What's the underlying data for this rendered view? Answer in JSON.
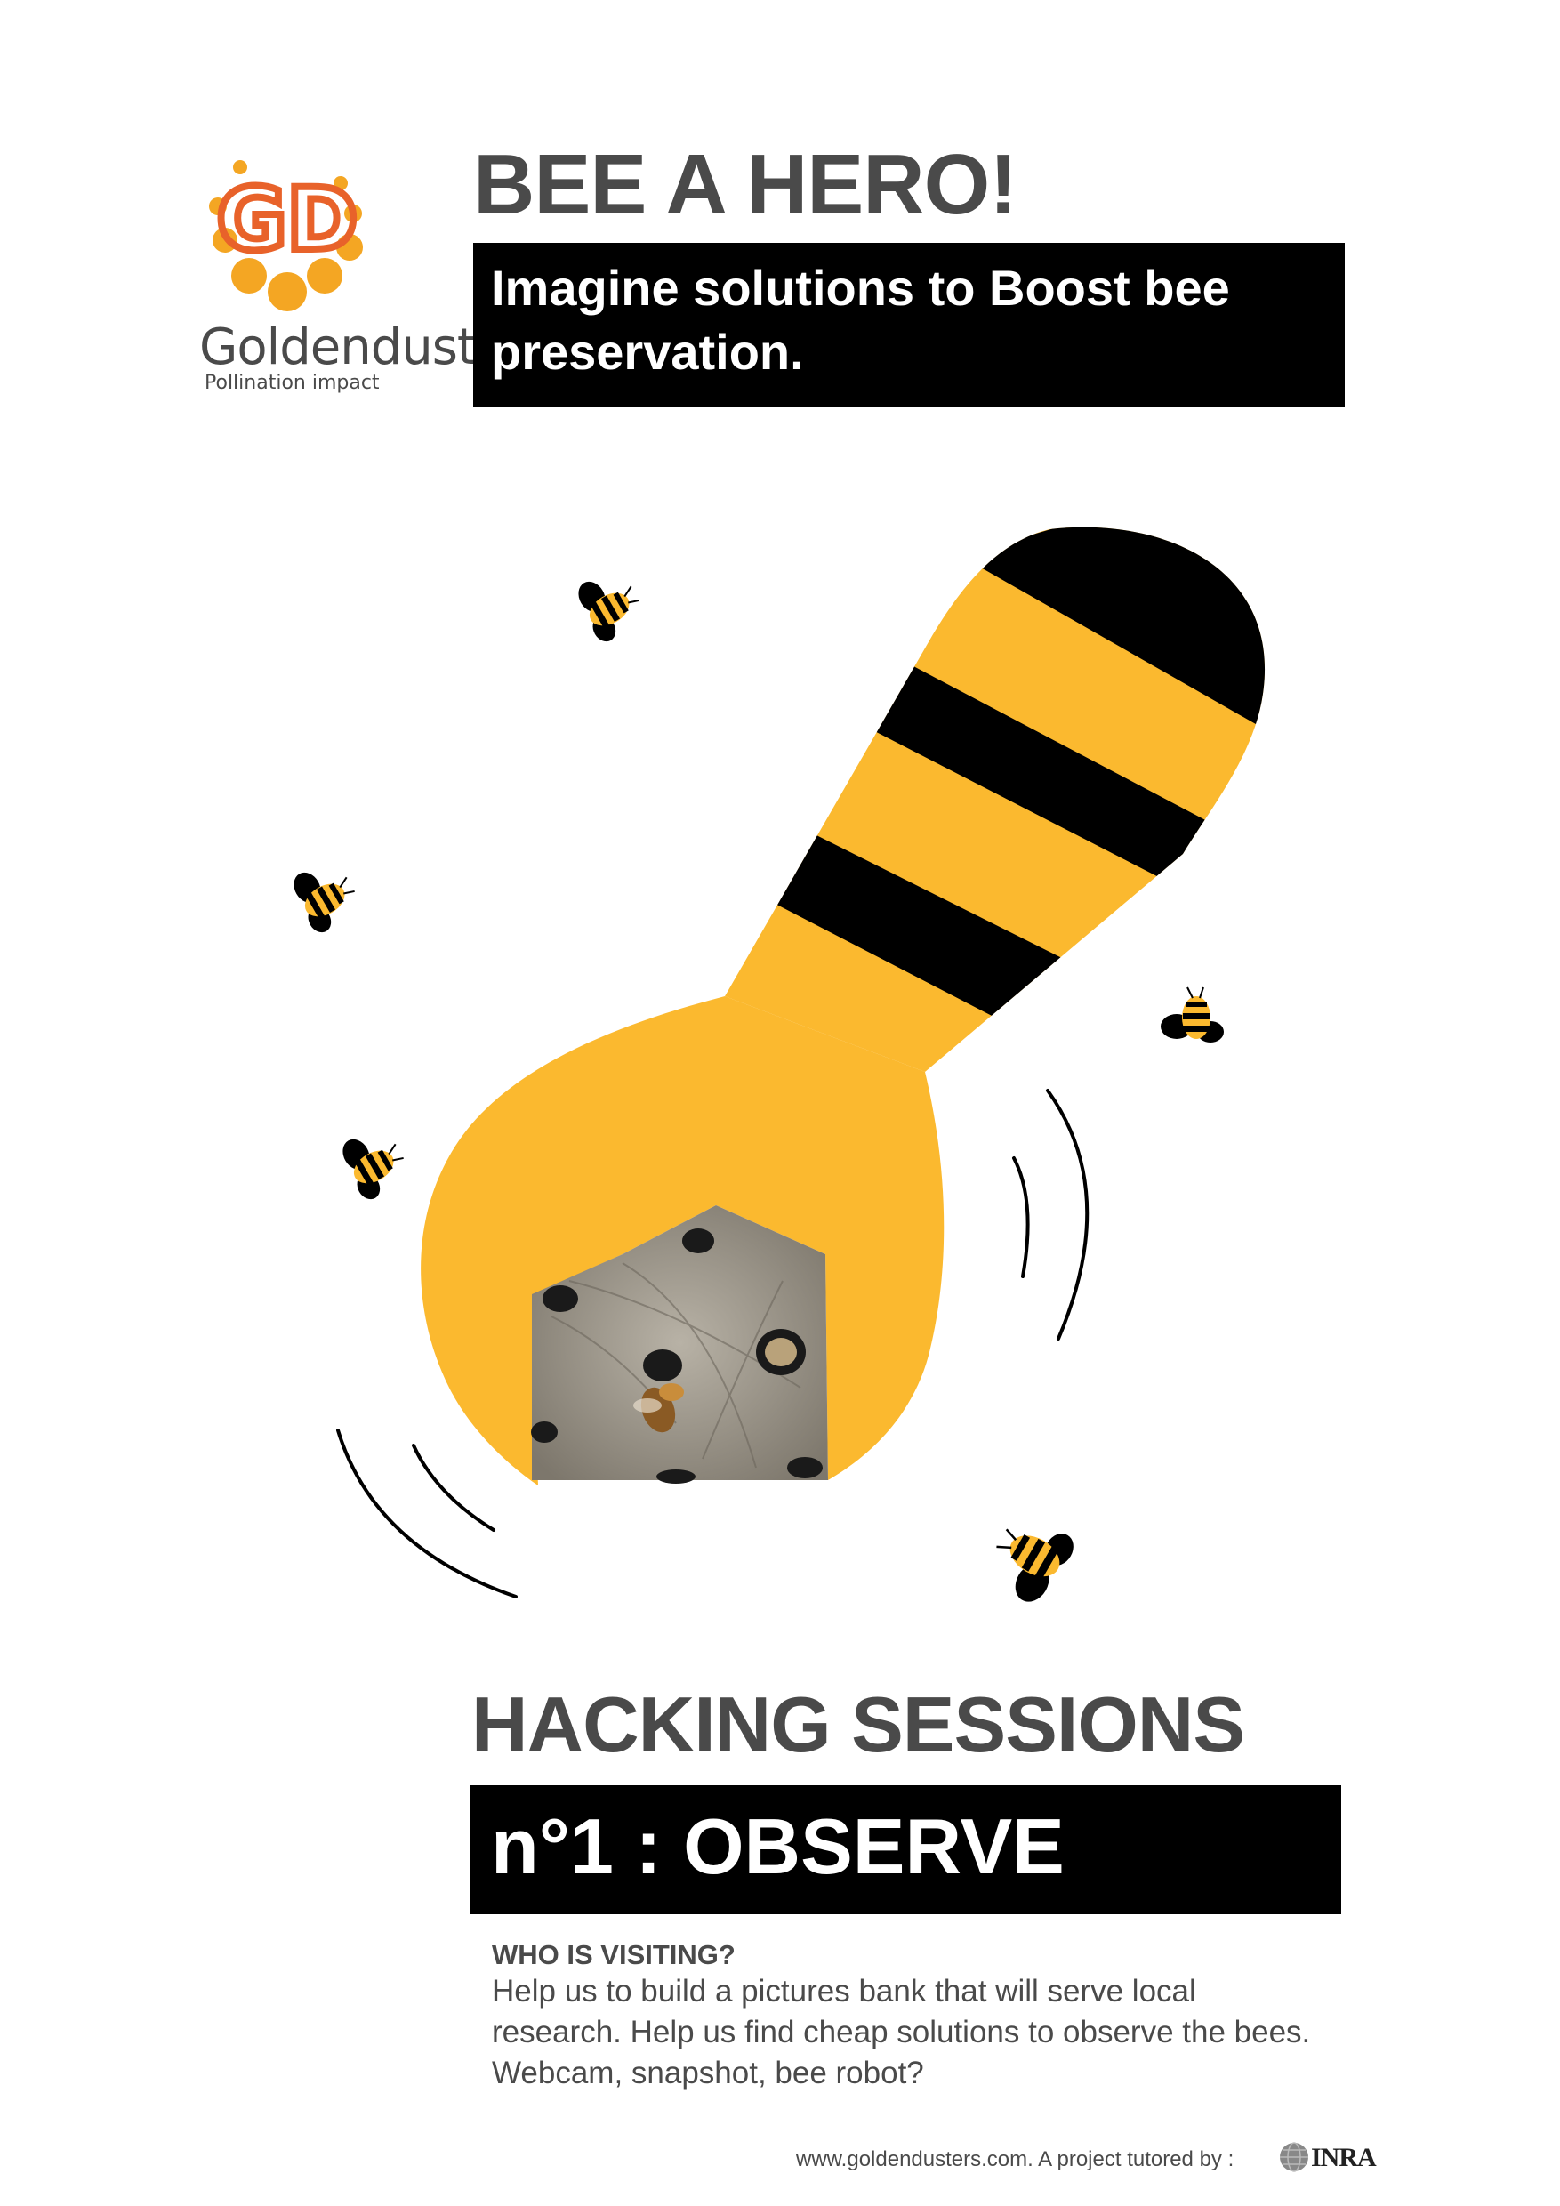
{
  "logo": {
    "monogram": "GD",
    "name": "Goldendust",
    "tagline": "Pollination impact",
    "accent": "#F4A623",
    "letter_color": "#E8622A"
  },
  "headline": "BEE A HERO!",
  "subhead": "Imagine solutions to Boost bee preservation.",
  "illustration": {
    "subject": "bee-striped wrench holding a bee hotel photo",
    "yellow": "#FBB92F",
    "black": "#000000"
  },
  "session": {
    "title": "HACKING SESSIONS",
    "label": "n°1 : OBSERVE"
  },
  "content": {
    "question": "WHO IS VISITING?",
    "body": "Help us to build a pictures bank that will serve local research. Help us find cheap solutions to observe the bees. Webcam, snapshot, bee robot?"
  },
  "footer": {
    "text": "www.goldendusters.com. A project tutored by :",
    "partner": "INRA"
  }
}
